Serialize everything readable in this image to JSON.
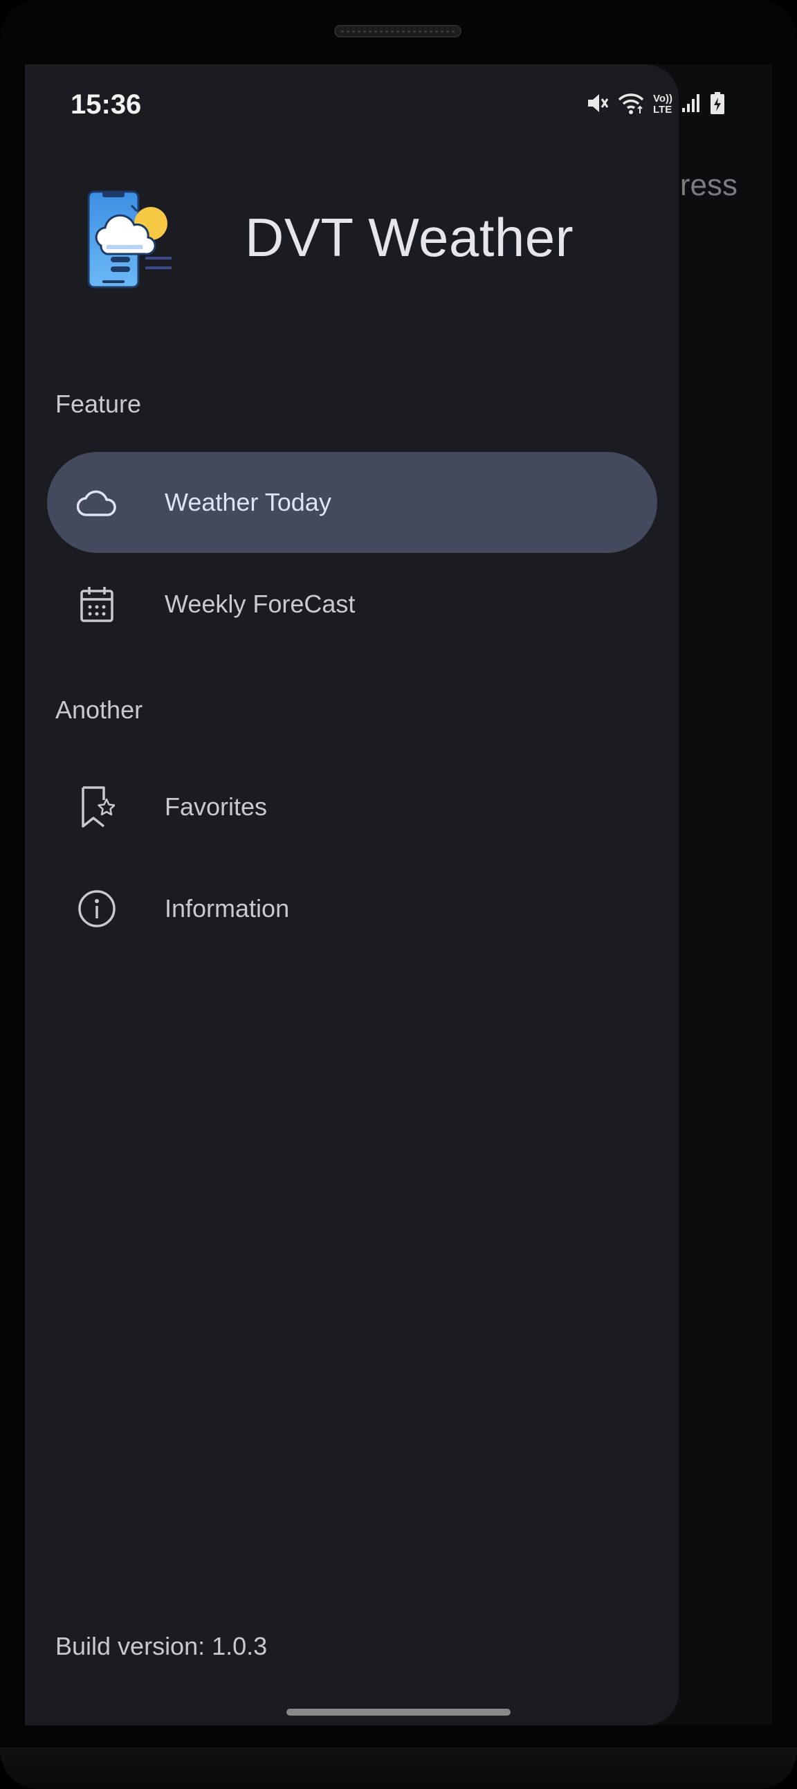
{
  "status_bar": {
    "time": "15:36",
    "icons": [
      "mute-icon",
      "wifi-icon",
      "volte-icon",
      "signal-icon",
      "battery-charging-icon"
    ],
    "volte_top": "Vo))",
    "volte_bottom": "LTE"
  },
  "background_screen": {
    "title_fragment": "ress"
  },
  "drawer": {
    "app_title": "DVT Weather",
    "logo_icon": "weather-app-logo",
    "sections": [
      {
        "label": "Feature",
        "items": [
          {
            "label": "Weather Today",
            "icon": "cloud-icon",
            "active": true
          },
          {
            "label": "Weekly ForeCast",
            "icon": "calendar-icon",
            "active": false
          }
        ]
      },
      {
        "label": "Another",
        "items": [
          {
            "label": "Favorites",
            "icon": "bookmark-star-icon",
            "active": false
          },
          {
            "label": "Information",
            "icon": "info-icon",
            "active": false
          }
        ]
      }
    ],
    "build_version": "Build version: 1.0.3"
  },
  "colors": {
    "drawer_bg": "#1b1c21",
    "active_item_bg": "#434a5d",
    "text": "#c9cacf",
    "title": "#e6e6ea"
  }
}
